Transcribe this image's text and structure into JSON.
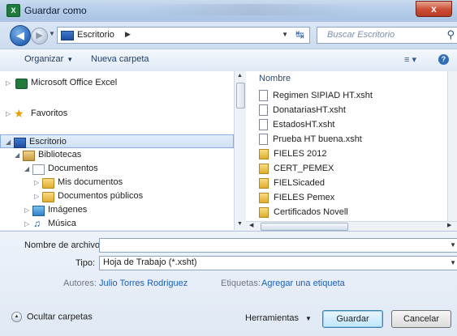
{
  "window": {
    "title": "Guardar como",
    "app_icon_letter": "X",
    "close_glyph": "x"
  },
  "address": {
    "location": "Escritorio",
    "search_placeholder": "Buscar Escritorio"
  },
  "toolbar": {
    "organize_label": "Organizar",
    "new_folder_label": "Nueva carpeta"
  },
  "nav": {
    "items": [
      {
        "label": "Microsoft Office Excel"
      },
      {
        "label": "Favoritos"
      },
      {
        "label": "Escritorio"
      },
      {
        "label": "Bibliotecas"
      },
      {
        "label": "Documentos"
      },
      {
        "label": "Mis documentos"
      },
      {
        "label": "Documentos públicos"
      },
      {
        "label": "Imágenes"
      },
      {
        "label": "Música"
      }
    ]
  },
  "files": {
    "column_header": "Nombre",
    "rows": [
      {
        "name": "Regimen SIPIAD HT.xsht",
        "type": "doc"
      },
      {
        "name": "DonatariasHT.xsht",
        "type": "doc"
      },
      {
        "name": "EstadosHT.xsht",
        "type": "doc"
      },
      {
        "name": "Prueba HT buena.xsht",
        "type": "doc"
      },
      {
        "name": "FIELES 2012",
        "type": "folder"
      },
      {
        "name": "CERT_PEMEX",
        "type": "folder"
      },
      {
        "name": "FIELSicaded",
        "type": "folder"
      },
      {
        "name": "FIELES Pemex",
        "type": "folder"
      },
      {
        "name": "Certificados Novell",
        "type": "folder"
      }
    ]
  },
  "form": {
    "filename_label": "Nombre de archivo:",
    "filename_value": "",
    "type_label": "Tipo:",
    "type_value": "Hoja de Trabajo (*.xsht)",
    "authors_label": "Autores:",
    "authors_value": "Julio Torres Rodriguez",
    "tags_label": "Etiquetas:",
    "tags_value": "Agregar una etiqueta"
  },
  "footer": {
    "hide_folders_label": "Ocultar carpetas",
    "tools_label": "Herramientas",
    "save_label": "Guardar",
    "cancel_label": "Cancelar"
  }
}
